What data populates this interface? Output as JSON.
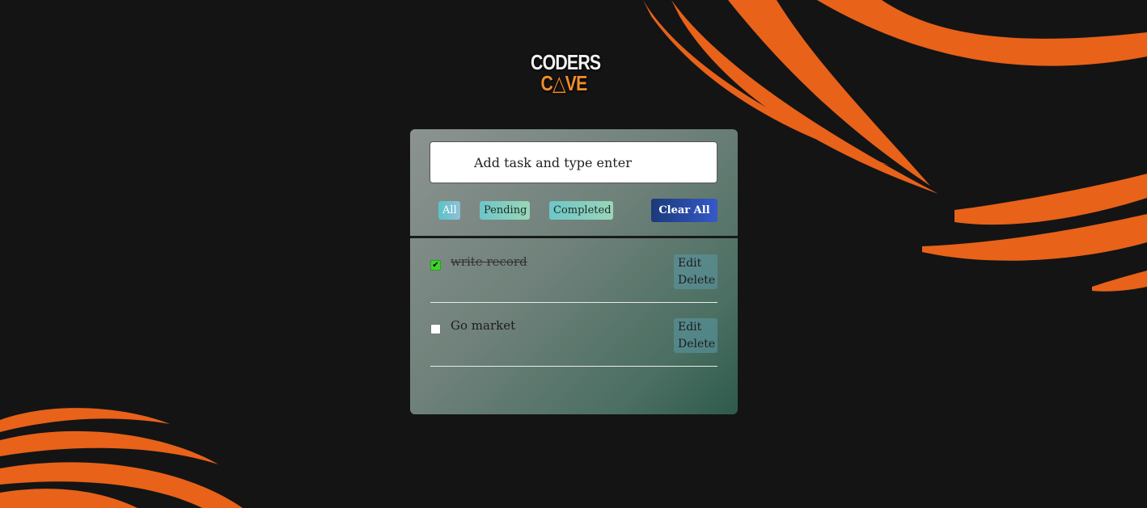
{
  "logo": {
    "line1": "CODERS",
    "line2": "C△VE",
    "accent_color": "#f28c28"
  },
  "input": {
    "placeholder": "Add task and type enter",
    "value": ""
  },
  "filters": {
    "all": "All",
    "pending": "Pending",
    "completed": "Completed",
    "active": "All"
  },
  "clear_all_label": "Clear All",
  "tasks": [
    {
      "text": "write record",
      "completed": true,
      "edit_label": "Edit",
      "delete_label": "Delete"
    },
    {
      "text": "Go market",
      "completed": false,
      "edit_label": "Edit",
      "delete_label": "Delete"
    }
  ],
  "colors": {
    "background": "#141414",
    "swoosh": "#e8621a",
    "clear_button": "#2a4aa8",
    "checkbox_checked": "#3fd22d"
  }
}
